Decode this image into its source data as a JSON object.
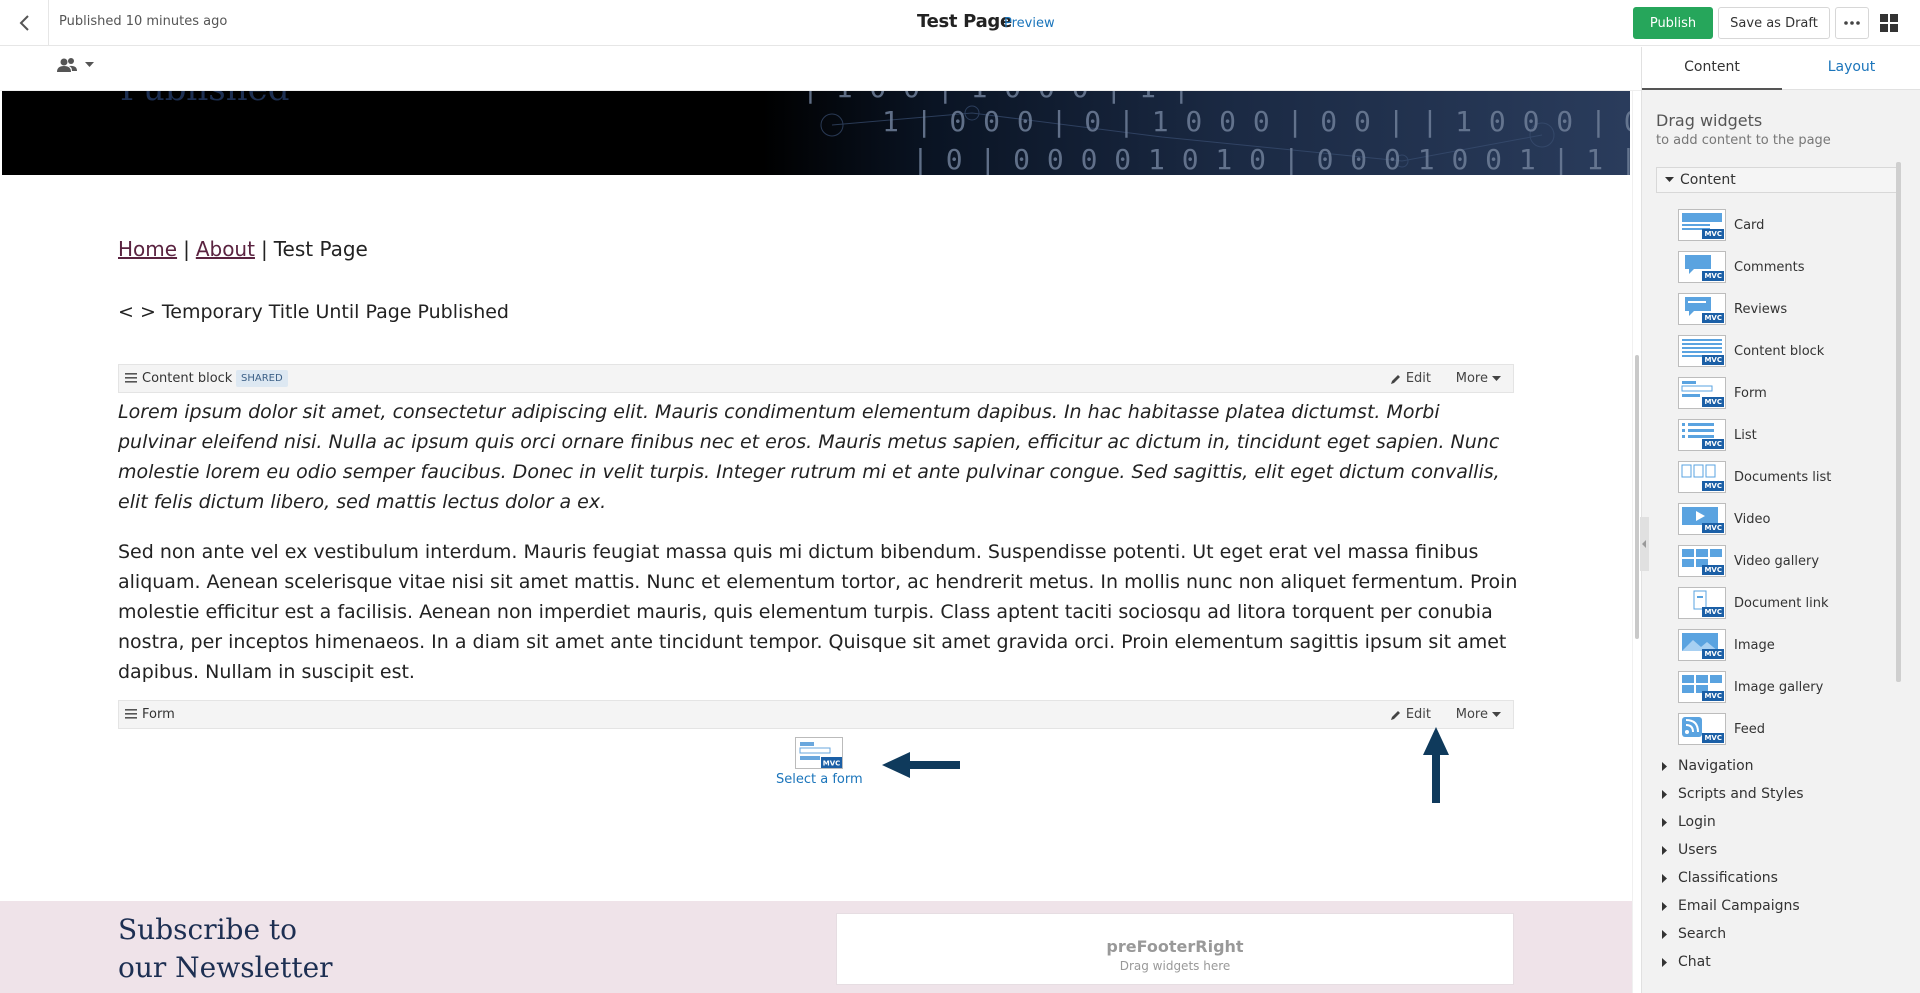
{
  "topbar": {
    "status": "Published 10 minutes ago",
    "title": "Test Page",
    "preview": "Preview",
    "publish": "Publish",
    "save_draft": "Save as Draft"
  },
  "banner": {
    "ghost_text": "Published"
  },
  "breadcrumb": {
    "home": "Home",
    "about": "About",
    "current": "Test Page",
    "sep": "|"
  },
  "page_title": "< > Temporary Title Until Page Published",
  "content_block": {
    "name": "Content block",
    "badge": "SHARED",
    "edit": "Edit",
    "more": "More",
    "para1": "Lorem ipsum dolor sit amet, consectetur adipiscing elit. Mauris condimentum elementum dapibus. In hac habitasse platea dictumst. Morbi pulvinar eleifend nisi. Nulla ac ipsum quis orci ornare finibus nec et eros. Mauris metus sapien, efficitur ac dictum in, tincidunt eget sapien. Nunc molestie lorem eu odio semper faucibus. Donec in velit turpis. Integer rutrum mi et ante pulvinar congue. Sed sagittis, elit eget dictum convallis, elit felis dictum libero, sed mattis lectus dolor a ex.",
    "para2": "Sed non ante vel ex vestibulum interdum. Mauris feugiat massa quis mi dictum bibendum. Suspendisse potenti. Ut eget erat vel massa finibus aliquam. Aenean scelerisque vitae nisi sit amet mattis. Nunc et elementum tortor, ac hendrerit metus. In mollis nunc non aliquet fermentum. Proin molestie efficitur est a facilisis. Aenean non imperdiet mauris, quis elementum turpis. Class aptent taciti sociosqu ad litora torquent per conubia nostra, per inceptos himenaeos. In a diam sit amet ante tincidunt tempor. Quisque sit amet gravida orci. Proin elementum sagittis ipsum sit amet dapibus. Nullam in suscipit est."
  },
  "form_widget": {
    "name": "Form",
    "edit": "Edit",
    "more": "More",
    "select": "Select a form"
  },
  "footer": {
    "newsletter_line1": "Subscribe to",
    "newsletter_line2": "our Newsletter",
    "zone_title": "preFooterRight",
    "zone_sub": "Drag widgets here"
  },
  "panel": {
    "tab_content": "Content",
    "tab_layout": "Layout",
    "heading": "Drag widgets",
    "subheading": "to add content to the page",
    "open_category": "Content",
    "mvc": "MVC",
    "widgets": [
      "Card",
      "Comments",
      "Reviews",
      "Content block",
      "Form",
      "List",
      "Documents list",
      "Video",
      "Video gallery",
      "Document link",
      "Image",
      "Image gallery",
      "Feed"
    ],
    "categories": [
      "Navigation",
      "Scripts and Styles",
      "Login",
      "Users",
      "Classifications",
      "Email Campaigns",
      "Search",
      "Chat"
    ]
  },
  "colors": {
    "publish_green": "#26a65b",
    "link_blue": "#1b75bb",
    "breadcrumb_link": "#5a2340",
    "arrow_navy": "#0f3a5c",
    "footer_pink": "#efe3e9"
  }
}
